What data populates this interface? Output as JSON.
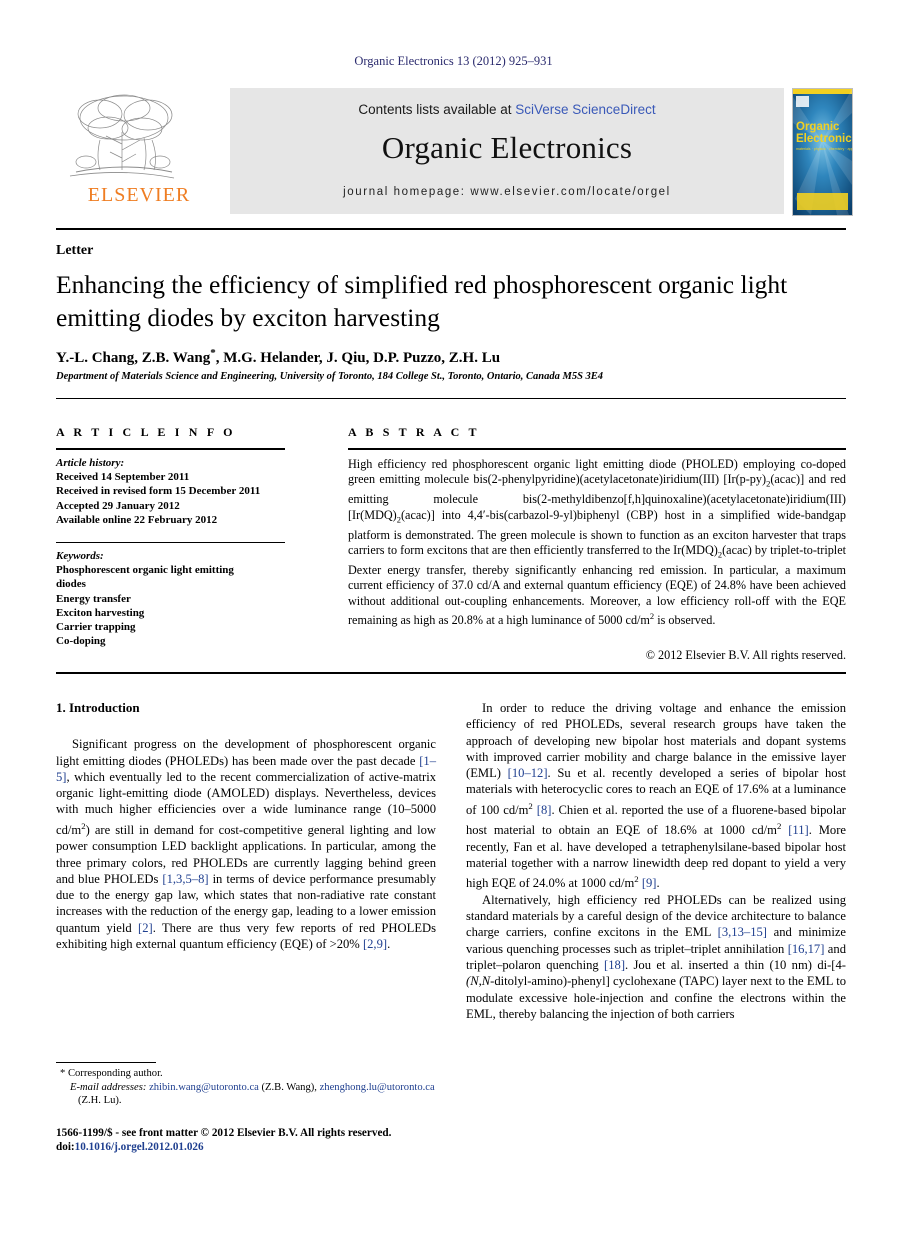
{
  "running_head": "Organic Electronics 13 (2012) 925–931",
  "masthead": {
    "contents_prefix": "Contents lists available at ",
    "sciencedirect": "SciVerse ScienceDirect",
    "journal_title": "Organic Electronics",
    "homepage": "journal homepage: www.elsevier.com/locate/orgel",
    "publisher_word": "ELSEVIER",
    "cover_title_line1": "Organic",
    "cover_title_line2": "Electronics",
    "cover_subtitle": "materials • physics • chemistry • applications"
  },
  "article": {
    "type_label": "Letter",
    "title": "Enhancing the efficiency of simplified red phosphorescent organic light emitting diodes by exciton harvesting",
    "authors": "Y.-L. Chang, Z.B. Wang",
    "authors_star": "*",
    "authors_rest": ", M.G. Helander, J. Qiu, D.P. Puzzo, Z.H. Lu",
    "affiliation": "Department of Materials Science and Engineering, University of Toronto, 184 College St., Toronto, Ontario, Canada M5S 3E4"
  },
  "info": {
    "heading": "A R T I C L E   I N F O",
    "history_label": "Article history:",
    "history": [
      "Received 14 September 2011",
      "Received in revised form 15 December 2011",
      "Accepted 29 January 2012",
      "Available online 22 February 2012"
    ],
    "keywords_label": "Keywords:",
    "keywords": [
      "Phosphorescent organic light emitting",
      "diodes",
      "Energy transfer",
      "Exciton harvesting",
      "Carrier trapping",
      "Co-doping"
    ]
  },
  "abstract": {
    "heading": "A B S T R A C T",
    "part1": "High efficiency red phosphorescent organic light emitting diode (PHOLED) employing co-doped green emitting molecule bis(2-phenylpyridine)(acetylacetonate)iridium(III) [Ir(p-py)",
    "sub1": "2",
    "part2": "(acac)] and red emitting molecule bis(2-methyldibenzo[f,h]quinoxaline)(acetylacetonate)iridium(III) [Ir(MDQ)",
    "sub2": "2",
    "part3": "(acac)] into 4,4′-bis(carbazol-9-yl)biphenyl (CBP) host in a simplified wide-bandgap platform is demonstrated. The green molecule is shown to function as an exciton harvester that traps carriers to form excitons that are then efficiently transferred to the Ir(MDQ)",
    "sub3": "2",
    "part4": "(acac) by triplet-to-triplet Dexter energy transfer, thereby significantly enhancing red emission. In particular, a maximum current efficiency of 37.0 cd/A and external quantum efficiency (EQE) of 24.8% have been achieved without additional out-coupling enhancements. Moreover, a low efficiency roll-off with the EQE remaining as high as 20.8% at a high luminance of 5000 cd/m",
    "sup1": "2",
    "part5": " is observed.",
    "copyright": "© 2012 Elsevier B.V. All rights reserved."
  },
  "body": {
    "section_heading": "1. Introduction",
    "left_p1_a": "Significant progress on the development of phosphorescent organic light emitting diodes (PHOLEDs) has been made over the past decade ",
    "left_cite1": "[1–5]",
    "left_p1_b": ", which eventually led to the recent commercialization of active-matrix organic light-emitting diode (AMOLED) displays. Nevertheless, devices with much higher efficiencies over a wide luminance range (10–5000 cd/m",
    "left_sup1": "2",
    "left_p1_c": ") are still in demand for cost-competitive general lighting and low power consumption LED backlight applications. In particular, among the three primary colors, red PHOLEDs are currently lagging behind green and blue PHOLEDs ",
    "left_cite2": "[1,3,5–8]",
    "left_p1_d": " in terms of device performance presumably due to the energy gap law, which states that non-radiative rate constant increases with the reduction of the energy gap, leading to a lower emission quantum yield ",
    "left_cite3": "[2]",
    "left_p1_e": ". There are thus very few reports of red PHOLEDs exhibiting high external quantum efficiency (EQE) of >20% ",
    "left_cite4": "[2,9]",
    "left_p1_f": ".",
    "right_p1_a": "In order to reduce the driving voltage and enhance the emission efficiency of red PHOLEDs, several research groups have taken the approach of developing new bipolar host materials and dopant systems with improved carrier mobility and charge balance in the emissive layer (EML) ",
    "right_cite1": "[10–12]",
    "right_p1_b": ". Su et al. recently developed a series of bipolar host materials with heterocyclic cores to reach an EQE of 17.6% at a luminance of 100 cd/m",
    "right_sup1": "2",
    "right_p1_c": " ",
    "right_cite2": "[8]",
    "right_p1_d": ". Chien et al. reported the use of a fluorene-based bipolar host material to obtain an EQE of 18.6% at 1000 cd/m",
    "right_sup2": "2",
    "right_p1_e": " ",
    "right_cite3": "[11]",
    "right_p1_f": ". More recently, Fan et al. have developed a tetraphenylsilane-based bipolar host material together with a narrow linewidth deep red dopant to yield a very high EQE of 24.0% at 1000 cd/m",
    "right_sup3": "2",
    "right_p1_g": " ",
    "right_cite4": "[9]",
    "right_p1_h": ".",
    "right_p2_a": "Alternatively, high efficiency red PHOLEDs can be realized using standard materials by a careful design of the device architecture to balance charge carriers, confine excitons in the EML ",
    "right_cite5": "[3,13–15]",
    "right_p2_b": " and minimize various quenching processes such as triplet–triplet annihilation ",
    "right_cite6": "[16,17]",
    "right_p2_c": " and triplet–polaron quenching ",
    "right_cite7": "[18]",
    "right_p2_d": ". Jou et al. inserted a thin (10 nm) di-[4-",
    "right_ital1": "(N,N",
    "right_p2_e": "-ditolyl-amino)-phenyl] cyclohexane (TAPC) layer next to the EML to modulate excessive hole-injection and confine the electrons within the EML, thereby balancing the injection of both carriers"
  },
  "footnote": {
    "corresponding": "* Corresponding author.",
    "email_label": "E-mail addresses:",
    "email1": "zhibin.wang@utoronto.ca",
    "email1_owner": " (Z.B. Wang), ",
    "email2": "zhenghong.lu@utoronto.ca",
    "email2_owner": " (Z.H. Lu)."
  },
  "imprint": {
    "line1": "1566-1199/$ - see front matter © 2012 Elsevier B.V. All rights reserved.",
    "doi_label": "doi:",
    "doi_value": "10.1016/j.orgel.2012.01.026"
  },
  "colors": {
    "link_blue": "#1f3f8f",
    "header_blue": "#2b2b6e",
    "elsevier_orange": "#ef7d22",
    "band_gray": "#e6e6e6"
  }
}
